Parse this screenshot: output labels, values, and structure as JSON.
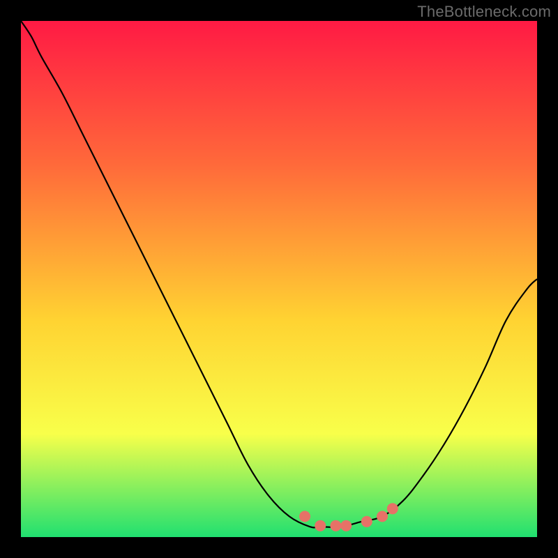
{
  "watermark": "TheBottleneck.com",
  "colors": {
    "watermark": "#6b6b6b",
    "gradient_top": "#ff1a44",
    "gradient_mid1": "#ff6a3a",
    "gradient_mid2": "#ffd332",
    "gradient_mid3": "#f8ff4a",
    "gradient_bottom": "#20e070",
    "curve": "#000000",
    "dots": "#e77267"
  },
  "chart_data": {
    "type": "line",
    "title": "",
    "xlabel": "",
    "ylabel": "",
    "xlim": [
      0,
      1
    ],
    "ylim": [
      0,
      1
    ],
    "series": [
      {
        "name": "bottleneck-curve",
        "x": [
          0.0,
          0.02,
          0.04,
          0.08,
          0.12,
          0.16,
          0.2,
          0.24,
          0.28,
          0.32,
          0.36,
          0.4,
          0.44,
          0.48,
          0.52,
          0.56,
          0.58,
          0.62,
          0.66,
          0.7,
          0.74,
          0.78,
          0.82,
          0.86,
          0.9,
          0.94,
          0.98,
          1.0
        ],
        "y": [
          1.0,
          0.97,
          0.93,
          0.86,
          0.78,
          0.7,
          0.62,
          0.54,
          0.46,
          0.38,
          0.3,
          0.22,
          0.14,
          0.08,
          0.04,
          0.02,
          0.02,
          0.02,
          0.03,
          0.04,
          0.07,
          0.12,
          0.18,
          0.25,
          0.33,
          0.42,
          0.48,
          0.5
        ]
      }
    ],
    "highlight_dots": {
      "name": "optimal-range-dots",
      "x": [
        0.55,
        0.58,
        0.61,
        0.63,
        0.67,
        0.7,
        0.72
      ],
      "y": [
        0.04,
        0.022,
        0.022,
        0.022,
        0.03,
        0.04,
        0.055
      ]
    },
    "gradient_stops": [
      {
        "offset": 0.0,
        "color": "#ff1a44"
      },
      {
        "offset": 0.28,
        "color": "#ff6a3a"
      },
      {
        "offset": 0.58,
        "color": "#ffd332"
      },
      {
        "offset": 0.8,
        "color": "#f8ff4a"
      },
      {
        "offset": 1.0,
        "color": "#20e070"
      }
    ]
  }
}
